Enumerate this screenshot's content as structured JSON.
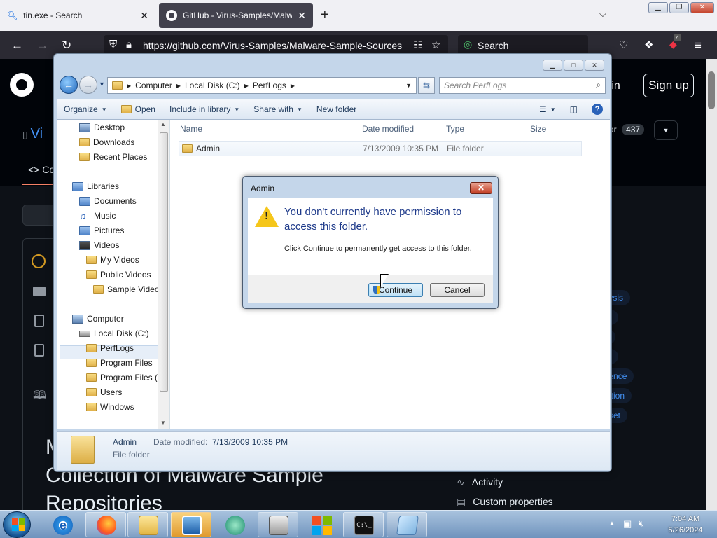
{
  "browser": {
    "tabs": [
      {
        "label": "tin.exe - Search",
        "icon": "search-icon",
        "active": false
      },
      {
        "label": "GitHub - Virus-Samples/Malwa",
        "icon": "github-icon",
        "active": true
      }
    ],
    "url": "https://github.com/Virus-Samples/Malware-Sample-Sources",
    "search_label": "Search",
    "extension_badge": "4"
  },
  "github": {
    "signin_label": "n in",
    "signup_label": "Sign up",
    "star_count": "437",
    "star_label": "ar",
    "repo_prefix": "Vi",
    "code_tab": "Co",
    "title": "Collection of Malware Sample Repositories",
    "title_partial": "M",
    "tags": [
      "alysis",
      "es",
      "is",
      "ng",
      "igence",
      "ection",
      "taset"
    ],
    "sidebar": [
      "Activity",
      "Custom properties"
    ]
  },
  "explorer": {
    "breadcrumb": [
      "Computer",
      "Local Disk (C:)",
      "PerfLogs"
    ],
    "search_placeholder": "Search PerfLogs",
    "toolbar": {
      "organize": "Organize",
      "open": "Open",
      "include": "Include in library",
      "share": "Share with",
      "new_folder": "New folder"
    },
    "nav": {
      "favorites": [
        "Desktop",
        "Downloads",
        "Recent Places"
      ],
      "libraries_label": "Libraries",
      "libraries": [
        "Documents",
        "Music",
        "Pictures",
        "Videos"
      ],
      "videos_children": [
        "My Videos",
        "Public Videos"
      ],
      "public_children": [
        "Sample Videos"
      ],
      "computer_label": "Computer",
      "local_disk": "Local Disk (C:)",
      "drive_children": [
        "PerfLogs",
        "Program Files",
        "Program Files (",
        "Users",
        "Windows"
      ]
    },
    "columns": [
      "Name",
      "Date modified",
      "Type",
      "Size"
    ],
    "files": [
      {
        "name": "Admin",
        "modified": "7/13/2009 10:35 PM",
        "type": "File folder",
        "size": ""
      }
    ],
    "details": {
      "name": "Admin",
      "modified_label": "Date modified:",
      "modified": "7/13/2009 10:35 PM",
      "type": "File folder"
    }
  },
  "dialog": {
    "title": "Admin",
    "main_text": "You don't currently have permission to access this folder.",
    "sub_text": "Click Continue to permanently get access to this folder.",
    "continue_label": "Continue",
    "cancel_label": "Cancel"
  },
  "taskbar": {
    "time": "7:04 AM",
    "date": "5/26/2024"
  }
}
